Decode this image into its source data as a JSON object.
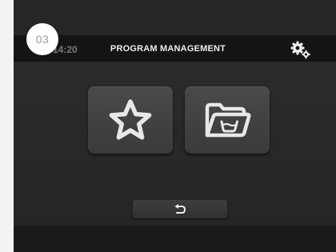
{
  "step_badge": "03",
  "header": {
    "time": "14:20",
    "title": "PROGRAM MANAGEMENT"
  },
  "icons": {
    "settings": "gears-icon",
    "favorites": "star-icon",
    "folder": "wash-program-folder-icon",
    "back": "return-arrow-icon"
  },
  "colors": {
    "screen_bg": "#2a2a2a",
    "tile_bg": "#454545",
    "icon": "#e8e8e8",
    "badge_bg": "#ffffff"
  }
}
